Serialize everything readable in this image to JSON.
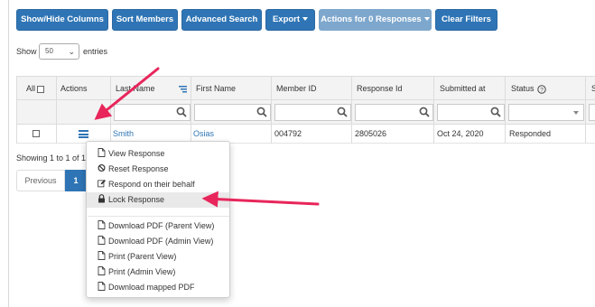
{
  "toolbar": {
    "show_hide_columns": "Show/Hide Columns",
    "sort_members": "Sort Members",
    "advanced_search": "Advanced Search",
    "export": "Export",
    "actions": "Actions for 0 Responses",
    "clear_filters": "Clear Filters"
  },
  "length": {
    "show": "Show",
    "value": "50",
    "entries": "entries"
  },
  "table": {
    "headers": {
      "all": "All",
      "actions": "Actions",
      "last_name": "Last Name",
      "first_name": "First Name",
      "member_id": "Member ID",
      "response_id": "Response Id",
      "submitted_at": "Submitted at",
      "status": "Status",
      "extra": "S"
    },
    "rows": [
      {
        "last_name": "Smith",
        "first_name": "Osias",
        "member_id": "004792",
        "response_id": "2805026",
        "submitted_at": "Oct 24, 2020",
        "status": "Responded"
      }
    ]
  },
  "info": "Showing 1 to 1 of 1",
  "pagination": {
    "previous": "Previous",
    "current": "1"
  },
  "menu": {
    "items": [
      {
        "label": "View Response",
        "icon": "file-icon"
      },
      {
        "label": "Reset Response",
        "icon": "ban-icon"
      },
      {
        "label": "Respond on their behalf",
        "icon": "edit-icon"
      },
      {
        "label": "Lock Response",
        "icon": "lock-icon"
      },
      {
        "label": "Download PDF (Parent View)",
        "icon": "file-icon"
      },
      {
        "label": "Download PDF (Admin View)",
        "icon": "file-icon"
      },
      {
        "label": "Print (Parent View)",
        "icon": "file-icon"
      },
      {
        "label": "Print (Admin View)",
        "icon": "file-icon"
      },
      {
        "label": "Download mapped PDF",
        "icon": "file-icon"
      }
    ]
  },
  "colors": {
    "primary": "#2f75b5",
    "disabled": "#7ea7cd",
    "arrow": "#e8265b"
  }
}
